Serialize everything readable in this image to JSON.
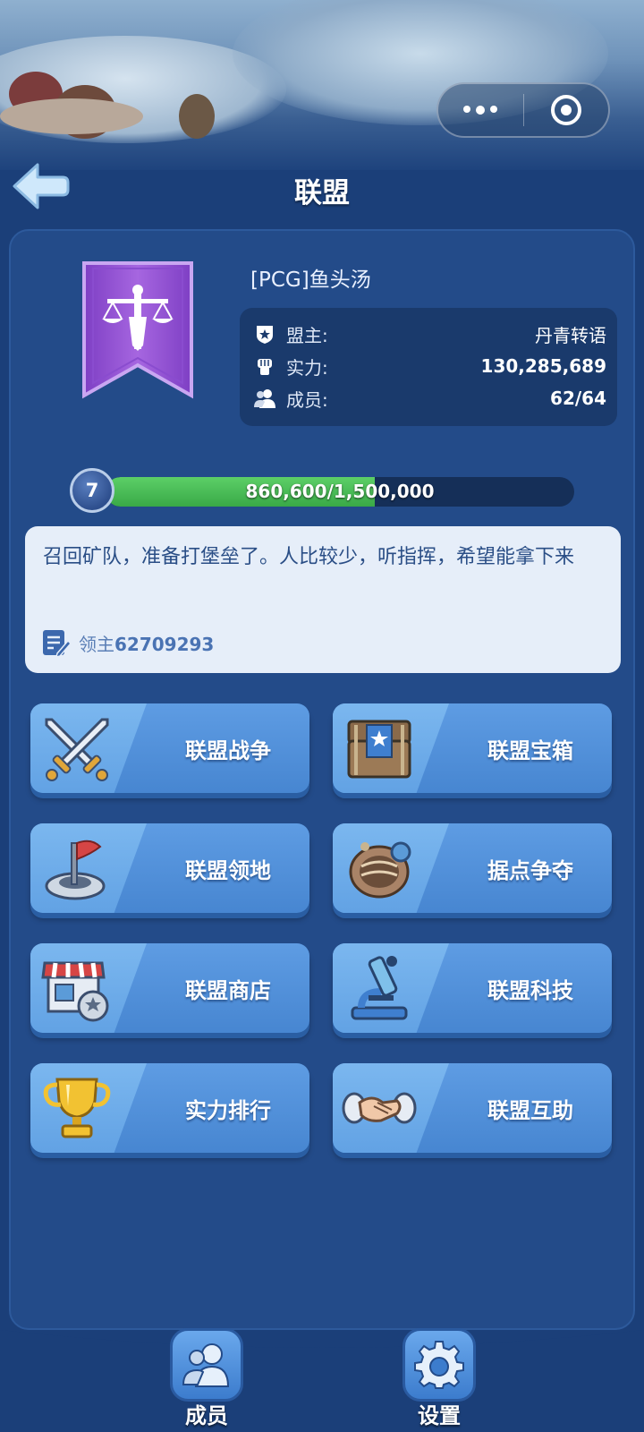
{
  "header": {
    "title": "联盟"
  },
  "guild": {
    "name": "[PCG]鱼头汤",
    "leader_label": "盟主:",
    "leader_value": "丹青转语",
    "power_label": "实力:",
    "power_value": "130,285,689",
    "members_label": "成员:",
    "members_value": "62/64"
  },
  "level": {
    "value": "7",
    "progress_text": "860,600/1,500,000",
    "progress_fraction": 0.5737
  },
  "notice": {
    "text": "召回矿队，准备打堡垒了。人比较少，听指挥，希望能拿下来",
    "author_prefix": "领主",
    "author_id": "62709293"
  },
  "features": [
    {
      "label": "联盟战争",
      "icon": "crossed-swords-icon"
    },
    {
      "label": "联盟宝箱",
      "icon": "treasure-chest-icon"
    },
    {
      "label": "联盟领地",
      "icon": "territory-flag-icon"
    },
    {
      "label": "据点争夺",
      "icon": "stronghold-shell-icon"
    },
    {
      "label": "联盟商店",
      "icon": "shop-icon"
    },
    {
      "label": "联盟科技",
      "icon": "microscope-icon"
    },
    {
      "label": "实力排行",
      "icon": "trophy-icon"
    },
    {
      "label": "联盟互助",
      "icon": "handshake-icon"
    }
  ],
  "bottom_nav": {
    "members_label": "成员",
    "settings_label": "设置"
  },
  "colors": {
    "background": "#1b3f79",
    "panel": "#234b89",
    "progress_fill": "#4bbd57",
    "banner_purple": "#9b59d6",
    "button_blue": "#5290dc"
  }
}
